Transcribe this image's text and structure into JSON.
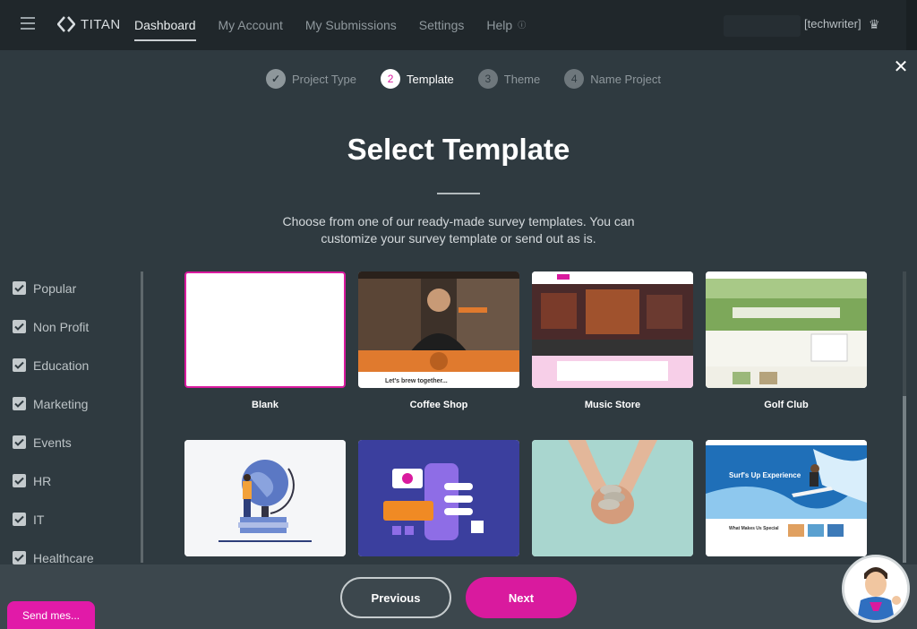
{
  "nav": {
    "brand": "TITAN",
    "items": [
      {
        "label": "Dashboard",
        "active": true
      },
      {
        "label": "My Account"
      },
      {
        "label": "My Submissions"
      },
      {
        "label": "Settings"
      },
      {
        "label": "Help"
      }
    ],
    "username": "[techwriter]"
  },
  "stepper": {
    "steps": [
      {
        "num": "1",
        "label": "Project Type",
        "state": "done"
      },
      {
        "num": "2",
        "label": "Template",
        "state": "current"
      },
      {
        "num": "3",
        "label": "Theme",
        "state": "todo"
      },
      {
        "num": "4",
        "label": "Name Project",
        "state": "todo"
      }
    ]
  },
  "heading": {
    "title": "Select Template",
    "subtitle": "Choose from one of our ready-made survey templates. You can customize your survey template or send out as is."
  },
  "categories": [
    {
      "label": "Popular",
      "checked": true
    },
    {
      "label": "Non Profit",
      "checked": true
    },
    {
      "label": "Education",
      "checked": true
    },
    {
      "label": "Marketing",
      "checked": true
    },
    {
      "label": "Events",
      "checked": true
    },
    {
      "label": "HR",
      "checked": true
    },
    {
      "label": "IT",
      "checked": true
    },
    {
      "label": "Healthcare",
      "checked": true
    }
  ],
  "templates": [
    {
      "label": "Blank",
      "selected": true
    },
    {
      "label": "Coffee Shop"
    },
    {
      "label": "Music Store"
    },
    {
      "label": "Golf Club"
    },
    {
      "label": ""
    },
    {
      "label": ""
    },
    {
      "label": ""
    },
    {
      "label": ""
    }
  ],
  "thumbnail_text": {
    "coffee": "Let's brew together...",
    "surf_title": "Surf's Up Experience",
    "surf_sub": "What Makes Us Special"
  },
  "footer": {
    "previous": "Previous",
    "next": "Next",
    "send_message": "Send mes..."
  },
  "colors": {
    "accent": "#d91a9e",
    "background": "#2f3a40",
    "topbar": "#20272b"
  }
}
